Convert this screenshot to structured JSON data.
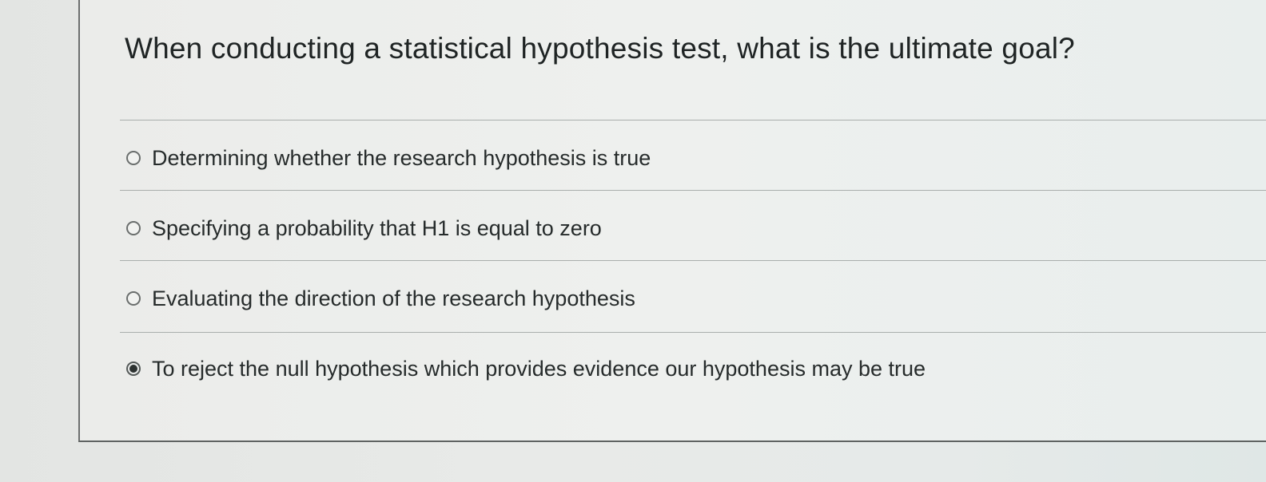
{
  "question": {
    "text": "When conducting a statistical hypothesis test, what is the ultimate goal?"
  },
  "answers": [
    {
      "label": "Determining whether the research hypothesis is true",
      "selected": false
    },
    {
      "label": "Specifying a probability that H1 is equal to zero",
      "selected": false
    },
    {
      "label": "Evaluating the direction of the research hypothesis",
      "selected": false
    },
    {
      "label": "To reject the null hypothesis which provides evidence our hypothesis may be true",
      "selected": true
    }
  ],
  "icons": {
    "unselected": "radio-unselected-icon",
    "selected": "radio-selected-icon"
  }
}
